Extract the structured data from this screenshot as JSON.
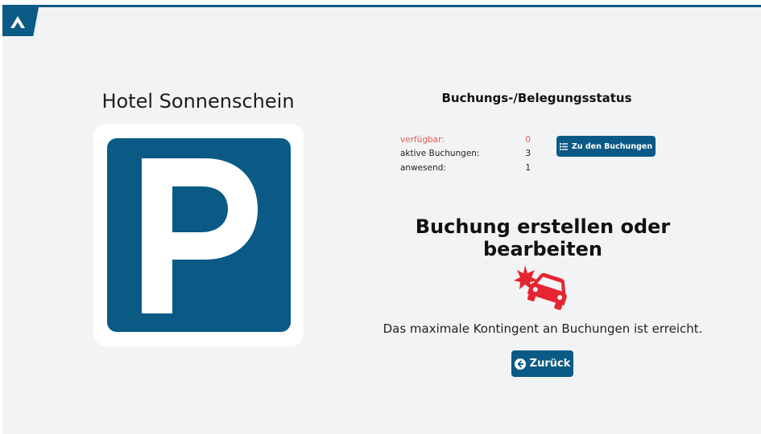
{
  "app": {
    "logo_icon": "brand-logo-icon",
    "accent_color": "#0a5a85"
  },
  "hotel": {
    "name": "Hotel Sonnenschein",
    "image_icon": "parking-sign-icon"
  },
  "status": {
    "title": "Buchungs-/Belegungsstatus",
    "rows": [
      {
        "label": "verfügbar:",
        "value": "0",
        "color": "#e85a5a"
      },
      {
        "label": "aktive Buchungen:",
        "value": "3"
      },
      {
        "label": "anwesend:",
        "value": "1"
      }
    ],
    "bookings_button": {
      "label": "Zu den Buchungen",
      "icon": "list-icon"
    }
  },
  "main": {
    "heading": "Buchung erstellen oder bearbeiten",
    "alert_icon": "car-crash-icon",
    "alert_color": "#e52531",
    "message": "Das maximale Kontingent an Buchungen ist erreicht.",
    "back_button": {
      "label": "Zurück",
      "icon": "arrow-circle-left-icon"
    }
  }
}
